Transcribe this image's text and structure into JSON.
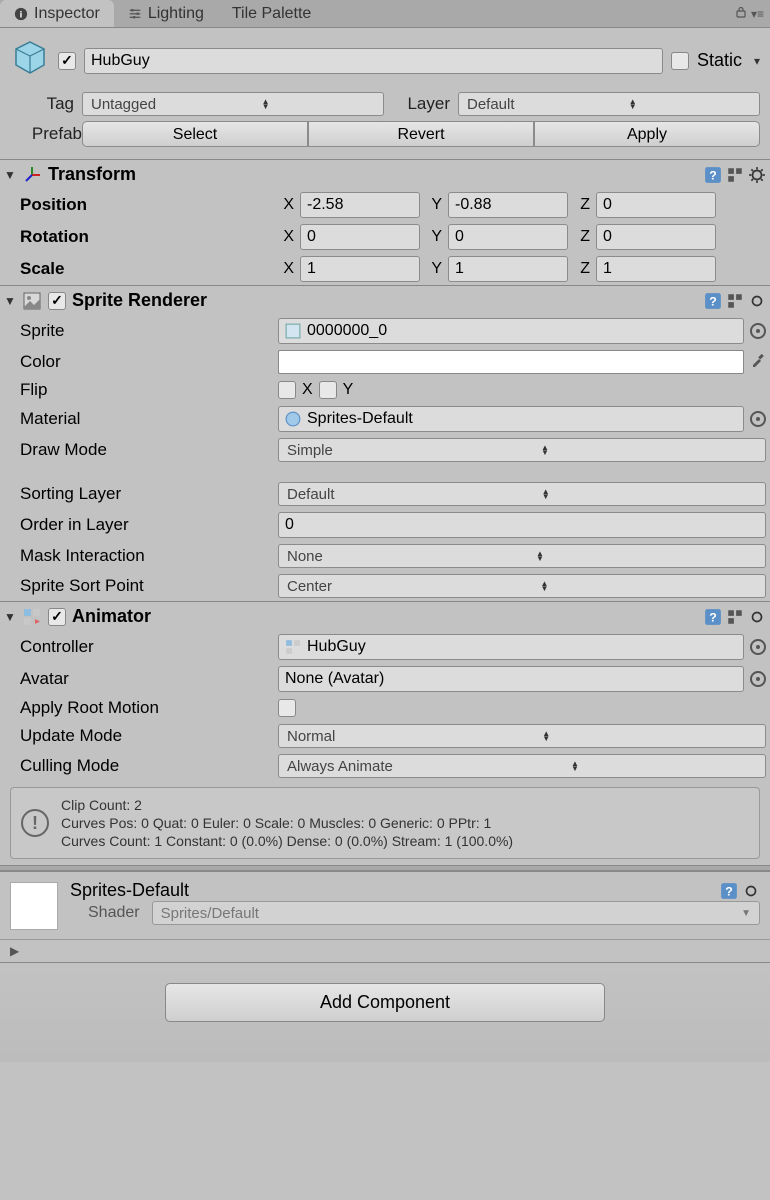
{
  "tabs": {
    "inspector": "Inspector",
    "lighting": "Lighting",
    "tile_palette": "Tile Palette"
  },
  "header": {
    "name": "HubGuy",
    "static_label": "Static",
    "tag_label": "Tag",
    "tag_value": "Untagged",
    "layer_label": "Layer",
    "layer_value": "Default",
    "prefab_label": "Prefab",
    "select_btn": "Select",
    "revert_btn": "Revert",
    "apply_btn": "Apply"
  },
  "transform": {
    "title": "Transform",
    "position_label": "Position",
    "rotation_label": "Rotation",
    "scale_label": "Scale",
    "x_label": "X",
    "y_label": "Y",
    "z_label": "Z",
    "position": {
      "x": "-2.58",
      "y": "-0.88",
      "z": "0"
    },
    "rotation": {
      "x": "0",
      "y": "0",
      "z": "0"
    },
    "scale": {
      "x": "1",
      "y": "1",
      "z": "1"
    }
  },
  "sprite_renderer": {
    "title": "Sprite Renderer",
    "sprite_label": "Sprite",
    "sprite_value": "0000000_0",
    "color_label": "Color",
    "flip_label": "Flip",
    "flip_x": "X",
    "flip_y": "Y",
    "material_label": "Material",
    "material_value": "Sprites-Default",
    "draw_mode_label": "Draw Mode",
    "draw_mode_value": "Simple",
    "sorting_layer_label": "Sorting Layer",
    "sorting_layer_value": "Default",
    "order_label": "Order in Layer",
    "order_value": "0",
    "mask_label": "Mask Interaction",
    "mask_value": "None",
    "sort_point_label": "Sprite Sort Point",
    "sort_point_value": "Center"
  },
  "animator": {
    "title": "Animator",
    "controller_label": "Controller",
    "controller_value": "HubGuy",
    "avatar_label": "Avatar",
    "avatar_value": "None (Avatar)",
    "root_motion_label": "Apply Root Motion",
    "update_mode_label": "Update Mode",
    "update_mode_value": "Normal",
    "culling_mode_label": "Culling Mode",
    "culling_mode_value": "Always Animate",
    "info_line1": "Clip Count: 2",
    "info_line2": "Curves Pos: 0 Quat: 0 Euler: 0 Scale: 0 Muscles: 0 Generic: 0 PPtr: 1",
    "info_line3": "Curves Count: 1 Constant: 0 (0.0%) Dense: 0 (0.0%) Stream: 1 (100.0%)"
  },
  "material": {
    "name": "Sprites-Default",
    "shader_label": "Shader",
    "shader_value": "Sprites/Default"
  },
  "add_component": "Add Component"
}
